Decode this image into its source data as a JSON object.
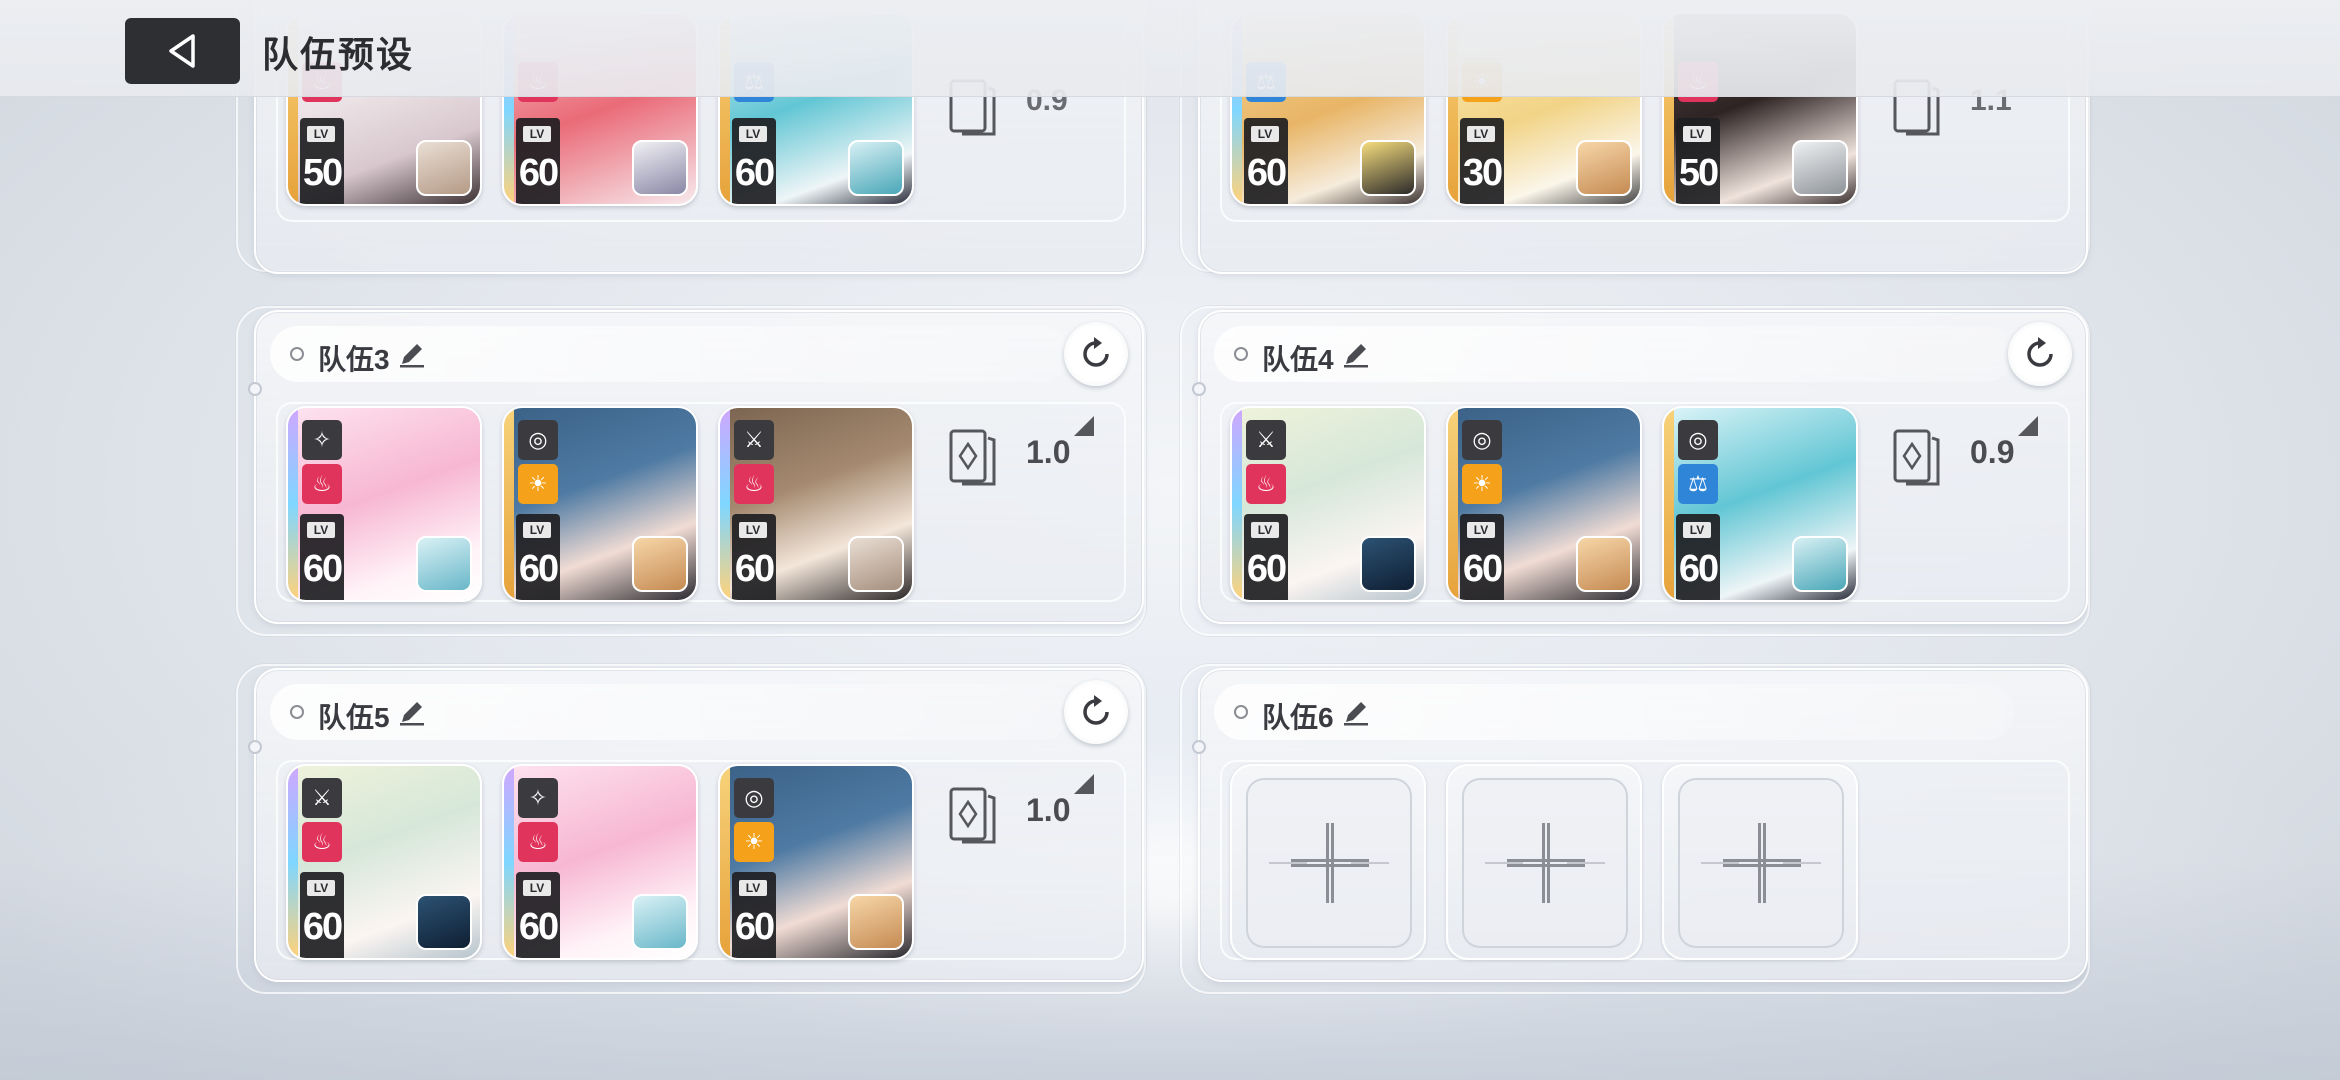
{
  "header": {
    "title": "队伍预设",
    "back_label": "back"
  },
  "colors": {
    "fire": "#e1345c",
    "light": "#f5a21a",
    "order": "#2f86d8",
    "rarity_gold": "#f1b64a",
    "rarity_rainbow": "#c9a3e6"
  },
  "teams": [
    {
      "id": "team1",
      "name": "",
      "cost": "0.9",
      "partial": true,
      "members": [
        {
          "level": "50",
          "element": "fire",
          "role": ""
        },
        {
          "level": "60",
          "element": "fire",
          "role": ""
        },
        {
          "level": "60",
          "element": "order",
          "role": ""
        }
      ]
    },
    {
      "id": "team2",
      "name": "",
      "cost": "1.1",
      "partial": true,
      "members": [
        {
          "level": "60",
          "element": "order",
          "role": ""
        },
        {
          "level": "30",
          "element": "light",
          "role": ""
        },
        {
          "level": "50",
          "element": "fire",
          "role": ""
        }
      ]
    },
    {
      "id": "team3",
      "name": "队伍3",
      "cost": "1.0",
      "members": [
        {
          "level": "60",
          "element": "fire",
          "role": "support"
        },
        {
          "level": "60",
          "element": "light",
          "role": "sniper"
        },
        {
          "level": "60",
          "element": "fire",
          "role": "melee"
        }
      ]
    },
    {
      "id": "team4",
      "name": "队伍4",
      "cost": "0.9",
      "members": [
        {
          "level": "60",
          "element": "fire",
          "role": "melee"
        },
        {
          "level": "60",
          "element": "light",
          "role": "sniper"
        },
        {
          "level": "60",
          "element": "order",
          "role": "sniper"
        }
      ]
    },
    {
      "id": "team5",
      "name": "队伍5",
      "cost": "1.0",
      "members": [
        {
          "level": "60",
          "element": "fire",
          "role": "melee"
        },
        {
          "level": "60",
          "element": "fire",
          "role": "support"
        },
        {
          "level": "60",
          "element": "light",
          "role": "sniper"
        }
      ]
    },
    {
      "id": "team6",
      "name": "队伍6",
      "empty": true
    }
  ]
}
